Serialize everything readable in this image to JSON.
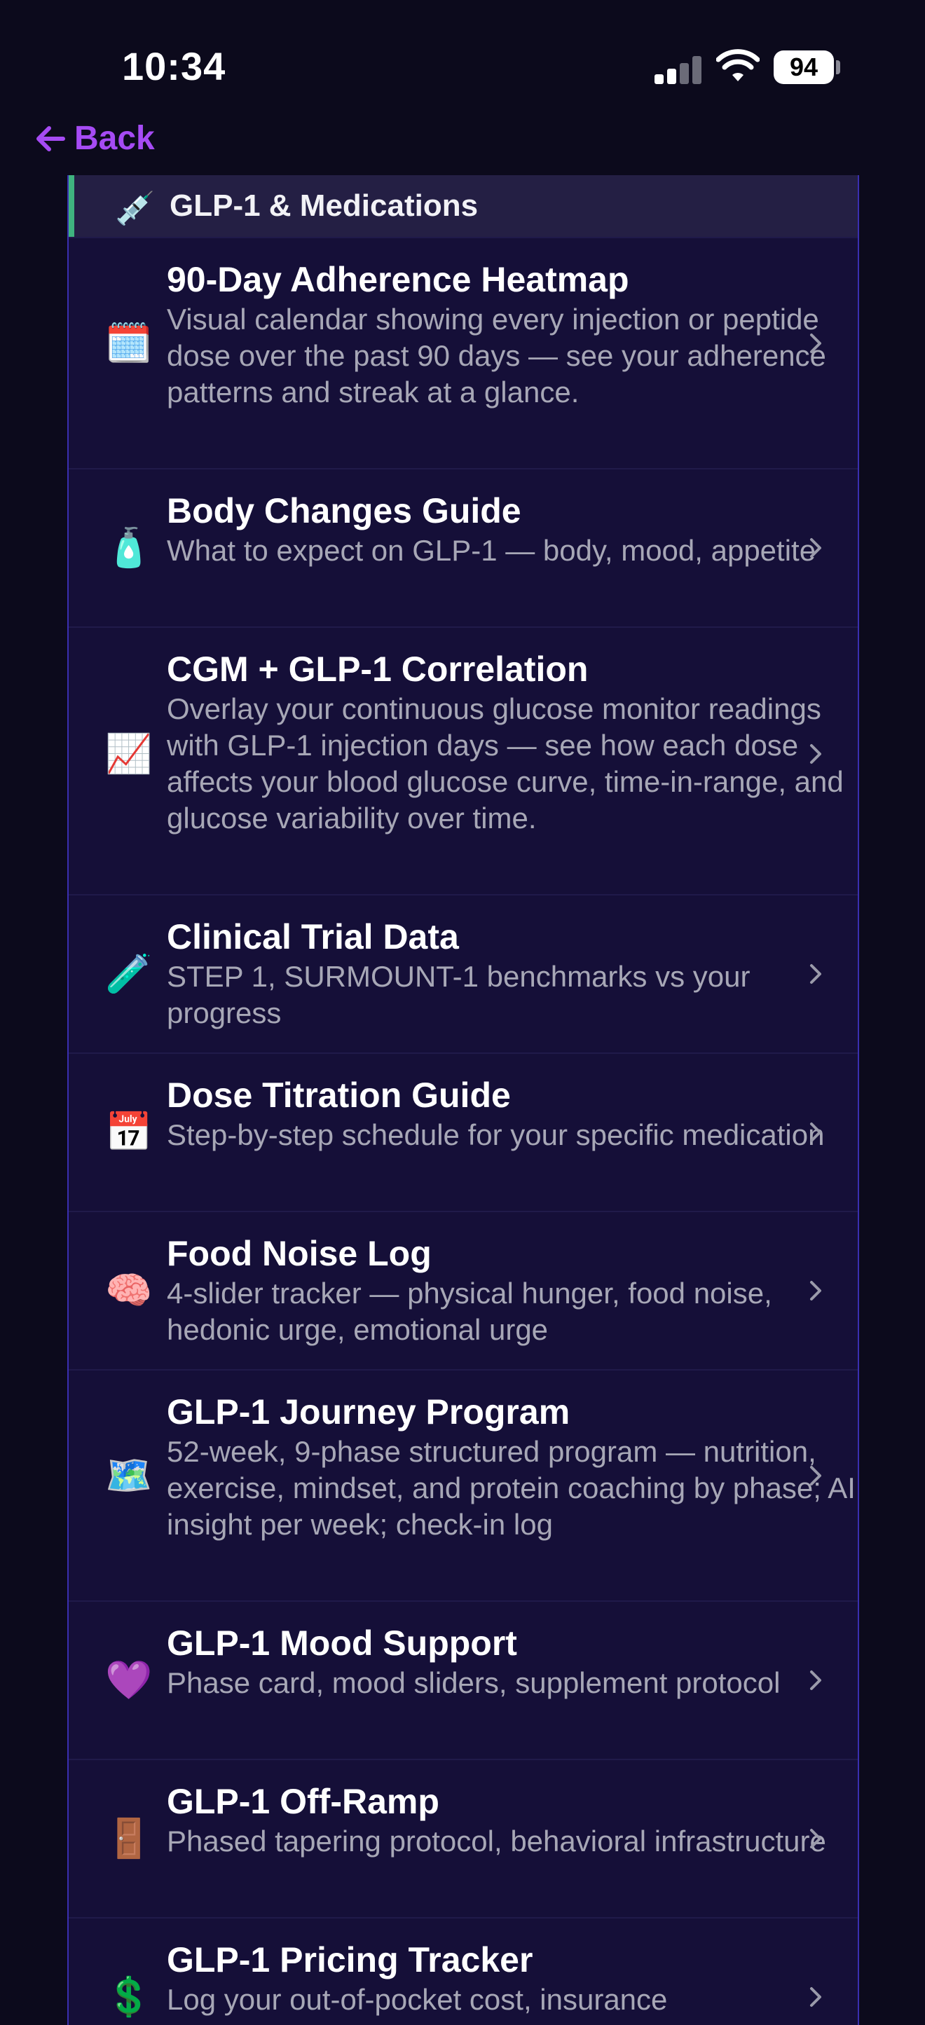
{
  "status_bar": {
    "time": "10:34",
    "battery": "94"
  },
  "nav": {
    "back_label": "Back"
  },
  "section": {
    "icon": "💉",
    "title": "GLP-1 & Medications"
  },
  "items": [
    {
      "icon": "🗓️",
      "title": "90-Day Adherence Heatmap",
      "description": "Visual calendar showing every injection or peptide dose over the past 90 days — see your adherence patterns and streak at a glance."
    },
    {
      "icon": "🧴",
      "title": "Body Changes Guide",
      "description": "What to expect on GLP-1 — body, mood, appetite"
    },
    {
      "icon": "📈",
      "title": "CGM + GLP-1 Correlation",
      "description": "Overlay your continuous glucose monitor readings with GLP-1 injection days — see how each dose affects your blood glucose curve, time-in-range, and glucose variability over time."
    },
    {
      "icon": "🧪",
      "title": "Clinical Trial Data",
      "description": "STEP 1, SURMOUNT-1 benchmarks vs your progress"
    },
    {
      "icon": "📅",
      "title": "Dose Titration Guide",
      "description": "Step-by-step schedule for your specific medication"
    },
    {
      "icon": "🧠",
      "title": "Food Noise Log",
      "description": "4-slider tracker — physical hunger, food noise, hedonic urge, emotional urge"
    },
    {
      "icon": "🗺️",
      "title": "GLP-1 Journey Program",
      "description": "52-week, 9-phase structured program — nutrition, exercise, mindset, and protein coaching by phase; AI insight per week; check-in log"
    },
    {
      "icon": "💜",
      "title": "GLP-1 Mood Support",
      "description": "Phase card, mood sliders, supplement protocol"
    },
    {
      "icon": "🚪",
      "title": "GLP-1 Off-Ramp",
      "description": "Phased tapering protocol, behavioral infrastructure"
    },
    {
      "icon": "💲",
      "title": "GLP-1 Pricing Tracker",
      "description": "Log your out-of-pocket cost, insurance"
    }
  ]
}
